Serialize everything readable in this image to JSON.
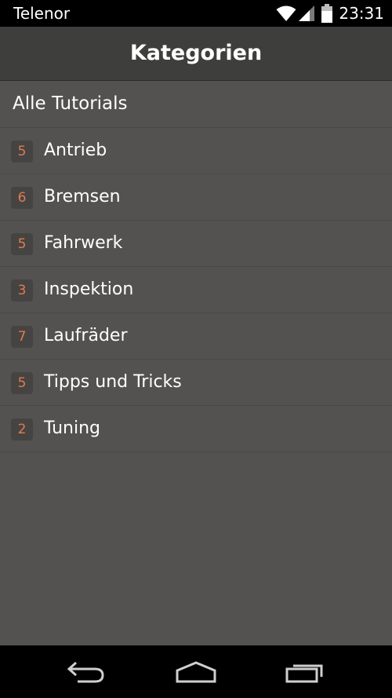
{
  "status_bar": {
    "carrier": "Telenor",
    "time": "23:31",
    "icons": [
      "wifi-icon",
      "signal-icon",
      "battery-icon"
    ]
  },
  "app_bar": {
    "title": "Kategorien"
  },
  "list": {
    "all_label": "Alle Tutorials",
    "items": [
      {
        "count": "5",
        "label": "Antrieb"
      },
      {
        "count": "6",
        "label": "Bremsen"
      },
      {
        "count": "5",
        "label": "Fahrwerk"
      },
      {
        "count": "3",
        "label": "Inspektion"
      },
      {
        "count": "7",
        "label": "Laufräder"
      },
      {
        "count": "5",
        "label": "Tipps und Tricks"
      },
      {
        "count": "2",
        "label": "Tuning"
      }
    ]
  },
  "nav_bar": {
    "buttons": [
      "back-icon",
      "home-icon",
      "recents-icon"
    ]
  },
  "colors": {
    "background": "#535250",
    "app_bar": "#3e3e3d",
    "badge_text": "#e07b4f",
    "badge_bg": "#454443",
    "divider": "#494847"
  }
}
